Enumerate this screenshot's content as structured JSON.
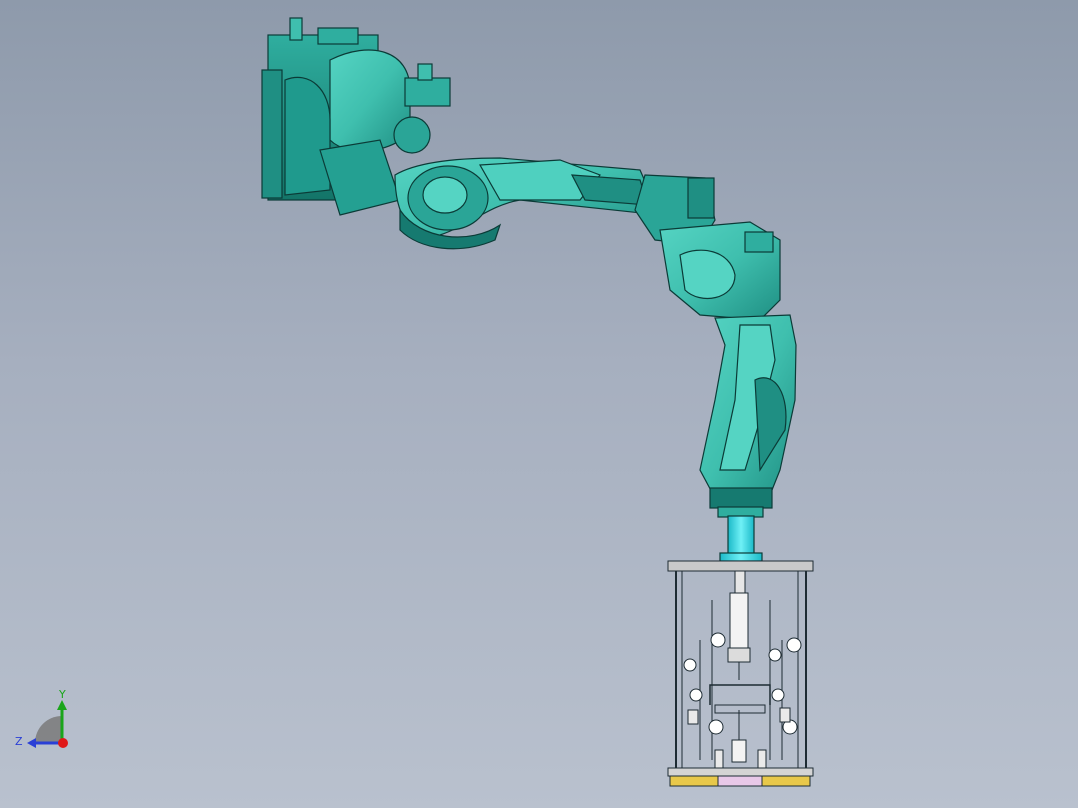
{
  "viewport": {
    "background_top": "#8e9aab",
    "background_bottom": "#b9c1ce"
  },
  "model": {
    "robot_color": "#3fbfae",
    "robot_dark": "#167a70",
    "robot_outline": "#0b3b37",
    "flange_color": "#38d8e4",
    "fixture_line": "#1d2b33",
    "fixture_plate": "#c9c9c9",
    "fixture_base": "#e8c84a",
    "fixture_base_center": "#e8c8e8"
  },
  "triad": {
    "y_label": "Y",
    "z_label": "Z",
    "y_color": "#1aa51a",
    "z_color": "#2a3fd6",
    "x_color": "#e01818",
    "arc_color": "#7a7a7a"
  },
  "icons": {
    "triad": "coordinate-triad-icon"
  }
}
